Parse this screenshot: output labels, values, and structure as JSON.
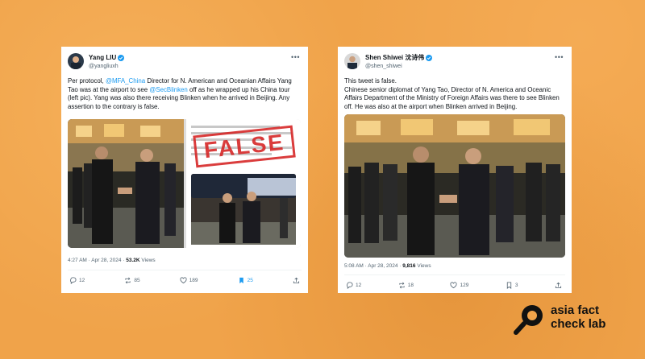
{
  "tweet1": {
    "display_name": "Yang LIU",
    "handle": "@yangliuxh",
    "text": {
      "p1": "Per protocol, ",
      "mention1": "@MFA_China",
      "p2": " Director for N. American and Oceanian Affairs Yang Tao was at the airport to see ",
      "mention2": "@SecBlinken",
      "p3": " off as he wrapped up his China tour (left pic). Yang was also there receiving Blinken when he arrived in Beijing. Any assertion to the contrary is false."
    },
    "stamp": "FALSE",
    "timestamp": "4:27 AM · Apr 28, 2024 · ",
    "views_count": "53.2K",
    "views_label": " Views",
    "actions": {
      "replies": "12",
      "reposts": "85",
      "likes": "189",
      "bookmarks": "25"
    }
  },
  "tweet2": {
    "display_name": "Shen Shiwei 沈诗伟",
    "handle": "@shen_shiwei",
    "text": {
      "line1": "This tweet is false.",
      "line2": "Chinese senior diplomat of Yang Tao, Director of N. America and Oceanic Affairs Department of the Ministry of Foreign Affairs was there to see Blinken off. He was also at the airport when Blinken arrived in Beijing."
    },
    "timestamp": "5:08 AM · Apr 28, 2024 · ",
    "views_count": "9,816",
    "views_label": " Views",
    "actions": {
      "replies": "12",
      "reposts": "18",
      "likes": "129",
      "bookmarks": "3"
    }
  },
  "logo": {
    "line1": "asia fact",
    "line2": "check lab"
  },
  "colors": {
    "background": "#f0a34a",
    "link": "#1d9bf0",
    "verified": "#1d9bf0",
    "stamp": "#d62828"
  }
}
